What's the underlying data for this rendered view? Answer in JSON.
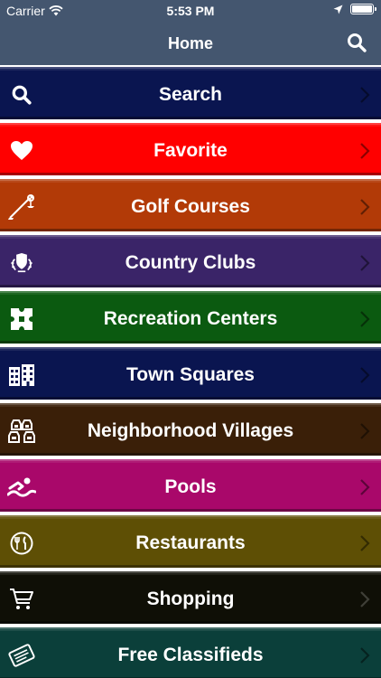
{
  "status_bar": {
    "carrier": "Carrier",
    "time": "5:53 PM"
  },
  "nav": {
    "title": "Home",
    "search_icon": "search-icon"
  },
  "menu": {
    "items": [
      {
        "label": "Search",
        "color": "#0a1550",
        "icon": "search-icon"
      },
      {
        "label": "Favorite",
        "color": "#ff0000",
        "icon": "heart-icon"
      },
      {
        "label": "Golf Courses",
        "color": "#b23a07",
        "icon": "golf-icon"
      },
      {
        "label": "Country Clubs",
        "color": "#3a2468",
        "icon": "crest-icon"
      },
      {
        "label": "Recreation Centers",
        "color": "#0b5a10",
        "icon": "puzzle-icon"
      },
      {
        "label": "Town Squares",
        "color": "#0a1550",
        "icon": "building-icon"
      },
      {
        "label": "Neighborhood Villages",
        "color": "#3a1f08",
        "icon": "houses-icon"
      },
      {
        "label": "Pools",
        "color": "#a9086a",
        "icon": "swimmer-icon"
      },
      {
        "label": "Restaurants",
        "color": "#5e4f05",
        "icon": "dining-icon"
      },
      {
        "label": "Shopping",
        "color": "#0f0f06",
        "icon": "cart-icon"
      },
      {
        "label": "Free Classifieds",
        "color": "#0b3f3a",
        "icon": "newspaper-icon"
      }
    ]
  }
}
